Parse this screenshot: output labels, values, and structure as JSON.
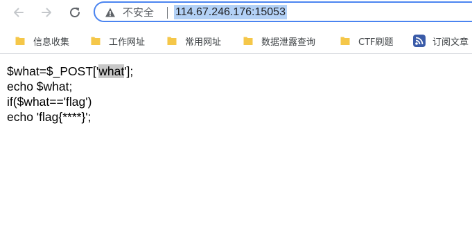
{
  "browser": {
    "security_label": "不安全",
    "url": "114.67.246.176:15053"
  },
  "bookmarks": [
    {
      "label": "信息收集",
      "icon": "folder-icon"
    },
    {
      "label": "工作网址",
      "icon": "folder-icon"
    },
    {
      "label": "常用网址",
      "icon": "folder-icon"
    },
    {
      "label": "数据泄露查询",
      "icon": "folder-icon"
    },
    {
      "label": "CTF刷题",
      "icon": "folder-icon"
    },
    {
      "label": "订阅文章",
      "icon": "rss-icon"
    }
  ],
  "page": {
    "line1_before": "$what=$_POST['",
    "line1_highlight": "what",
    "line1_after": "'];",
    "line2": "echo $what;",
    "line3": "if($what=='flag')",
    "line4": "echo 'flag{****}';"
  },
  "colors": {
    "omnibox_border": "#4a84f0",
    "url_selection": "#b3d1f6",
    "folder": "#f5c749",
    "text_highlight": "#c8c8c8"
  }
}
